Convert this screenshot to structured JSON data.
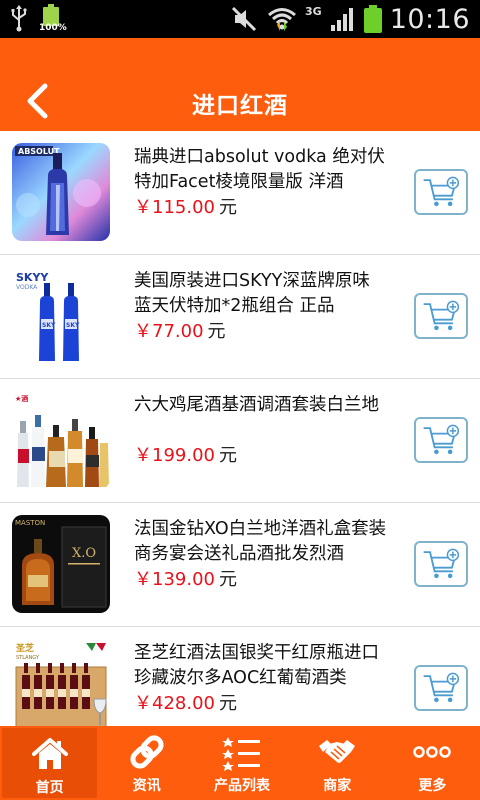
{
  "status_bar": {
    "battery_small_pct": "100%",
    "network": "3G",
    "time": "10:16"
  },
  "header": {
    "title": "进口红酒"
  },
  "products": [
    {
      "name": "瑞典进口absolut vodka 绝对伏特加Facet棱境限量版 洋酒",
      "price": "￥115.00",
      "unit": "元",
      "image": "absolut-vodka-bottle"
    },
    {
      "name": "美国原装进口SKYY深蓝牌原味 蓝天伏特加*2瓶组合 正品",
      "price": "￥77.00",
      "unit": "元",
      "image": "skyy-vodka-two-bottles"
    },
    {
      "name": "六大鸡尾酒基酒调酒套装白兰地",
      "price": "￥199.00",
      "unit": "元",
      "image": "cocktail-base-set"
    },
    {
      "name": "法国金钻XO白兰地洋酒礼盒套装商务宴会送礼品酒批发烈酒",
      "price": "￥139.00",
      "unit": "元",
      "image": "xo-brandy-gift-box"
    },
    {
      "name": "圣芝红酒法国银奖干红原瓶进口珍藏波尔多AOC红葡萄酒类",
      "price": "￥428.00",
      "unit": "元",
      "image": "saint-zhi-red-wine-set"
    }
  ],
  "bottom_nav": [
    {
      "label": "首页",
      "icon": "home-icon",
      "active": true
    },
    {
      "label": "资讯",
      "icon": "link-icon",
      "active": false
    },
    {
      "label": "产品列表",
      "icon": "list-icon",
      "active": false
    },
    {
      "label": "商家",
      "icon": "handshake-icon",
      "active": false
    },
    {
      "label": "更多",
      "icon": "more-icon",
      "active": false
    }
  ],
  "colors": {
    "accent": "#fe5d0e",
    "price": "#e8131a",
    "cart_border": "#7fb3cc"
  }
}
